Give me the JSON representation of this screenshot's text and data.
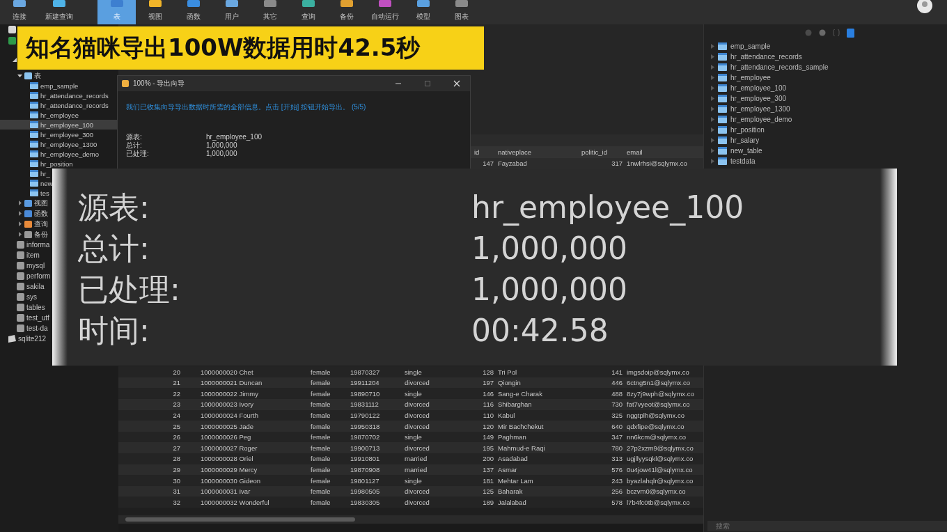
{
  "toolbar": {
    "items": [
      {
        "label": "连接",
        "selected": false
      },
      {
        "label": "新建查询",
        "selected": false
      },
      {
        "label": "表",
        "selected": true
      },
      {
        "label": "视图",
        "selected": false
      },
      {
        "label": "函数",
        "selected": false
      },
      {
        "label": "用户",
        "selected": false
      },
      {
        "label": "其它",
        "selected": false
      },
      {
        "label": "查询",
        "selected": false
      },
      {
        "label": "备份",
        "selected": false
      },
      {
        "label": "自动运行",
        "selected": false
      },
      {
        "label": "模型",
        "selected": false
      },
      {
        "label": "图表",
        "selected": false
      }
    ]
  },
  "banner": {
    "text": "知名猫咪导出100W数据用时42.5秒"
  },
  "sidebar": {
    "tree": [
      {
        "label": "表",
        "kind": "table",
        "expanded": true,
        "children": [
          {
            "label": "emp_sample",
            "selected": false
          },
          {
            "label": "hr_attendance_records",
            "selected": false
          },
          {
            "label": "hr_attendance_records",
            "selected": false
          },
          {
            "label": "hr_employee",
            "selected": false
          },
          {
            "label": "hr_employee_100",
            "selected": true
          },
          {
            "label": "hr_employee_300",
            "selected": false
          },
          {
            "label": "hr_employee_1300",
            "selected": false
          },
          {
            "label": "hr_employee_demo",
            "selected": false
          },
          {
            "label": "hr_position",
            "selected": false
          },
          {
            "label": "hr_",
            "selected": false
          },
          {
            "label": "new",
            "selected": false
          },
          {
            "label": "tes",
            "selected": false
          }
        ]
      },
      {
        "label": "视图",
        "kind": "view",
        "expanded": false
      },
      {
        "label": "函数",
        "kind": "function",
        "expanded": false
      },
      {
        "label": "查询",
        "kind": "query",
        "expanded": false
      },
      {
        "label": "备份",
        "kind": "backup",
        "expanded": false
      }
    ],
    "databases": [
      {
        "label": "informa"
      },
      {
        "label": "item"
      },
      {
        "label": "mysql"
      },
      {
        "label": "perform"
      },
      {
        "label": "sakila"
      },
      {
        "label": "sys"
      },
      {
        "label": "tables"
      },
      {
        "label": "test_utf"
      },
      {
        "label": "test-da"
      }
    ],
    "connections": [
      {
        "label": "sqlite212"
      }
    ]
  },
  "dialog": {
    "title": "100% - 导出向导",
    "message": "我们已收集向导导出数据时所需的全部信息。点击 [开始] 按钮开始导出。 (5/5)",
    "rows": [
      {
        "label": "源表:",
        "value": "hr_employee_100"
      },
      {
        "label": "总计:",
        "value": "1,000,000"
      },
      {
        "label": "已处理:",
        "value": "1,000,000"
      }
    ]
  },
  "inset": {
    "rows": [
      {
        "label": "源表:",
        "value": "hr_employee_100"
      },
      {
        "label": "总计:",
        "value": "1,000,000"
      },
      {
        "label": "已处理:",
        "value": "1,000,000"
      },
      {
        "label": "时间:",
        "value": "00:42.58"
      }
    ]
  },
  "results": {
    "header_labels": [
      "id",
      "nativeplace",
      "politic_id",
      "email"
    ],
    "top_row": [
      "147",
      "Fayzabad",
      "317",
      "1nwlrhsi@sqlymx.co"
    ],
    "rows": [
      [
        "20",
        "1000000020 Chet",
        "female",
        "19870327",
        "single",
        "128",
        "Tri Pol",
        "141",
        "imgsdoip@sqlymx.co"
      ],
      [
        "21",
        "1000000021 Duncan",
        "female",
        "19911204",
        "divorced",
        "197",
        "Qiongin",
        "446",
        "6ctng5n1@sqlymx.co"
      ],
      [
        "22",
        "1000000022 Jimmy",
        "female",
        "19890710",
        "single",
        "146",
        "Sang-e Charak",
        "488",
        "8zy7j9wph@sqlymx.co"
      ],
      [
        "23",
        "1000000023 Ivory",
        "female",
        "19831112",
        "divorced",
        "116",
        "Shibarghan",
        "730",
        "fat7vyeot@sqlymx.co"
      ],
      [
        "24",
        "1000000024 Fourth",
        "female",
        "19790122",
        "divorced",
        "110",
        "Kabul",
        "325",
        "nggtplh@sqlymx.co"
      ],
      [
        "25",
        "1000000025 Jade",
        "female",
        "19950318",
        "divorced",
        "120",
        "Mir Bachchekut",
        "640",
        "qdxfipe@sqlymx.co"
      ],
      [
        "26",
        "1000000026 Peg",
        "female",
        "19870702",
        "single",
        "149",
        "Paghman",
        "347",
        "nn6kcm@sqlymx.co"
      ],
      [
        "27",
        "1000000027 Roger",
        "female",
        "19900713",
        "divorced",
        "195",
        "Mahmud-e Raqi",
        "780",
        "27p2xzm9@sqlymx.co"
      ],
      [
        "28",
        "1000000028 Oriel",
        "female",
        "19910801",
        "married",
        "200",
        "Asadabad",
        "313",
        "ugjllyysqkl@sqlymx.co"
      ],
      [
        "29",
        "1000000029 Mercy",
        "female",
        "19870908",
        "married",
        "137",
        "Asmar",
        "576",
        "0u4jow41l@sqlymx.co"
      ],
      [
        "30",
        "1000000030 Gideon",
        "female",
        "19801127",
        "single",
        "181",
        "Mehtar Lam",
        "243",
        "byazlahqlr@sqlymx.co"
      ],
      [
        "31",
        "1000000031 Ivar",
        "female",
        "19980505",
        "divorced",
        "125",
        "Baharak",
        "256",
        "bczvm0@sqlymx.co"
      ],
      [
        "32",
        "1000000032 Wonderful",
        "female",
        "19830305",
        "divorced",
        "189",
        "Jalalabad",
        "578",
        "l7b4fc0tb@sqlymx.co"
      ]
    ]
  },
  "objects_panel": {
    "items": [
      {
        "label": "emp_sample"
      },
      {
        "label": "hr_attendance_records"
      },
      {
        "label": "hr_attendance_records_sample"
      },
      {
        "label": "hr_employee"
      },
      {
        "label": "hr_employee_100"
      },
      {
        "label": "hr_employee_300"
      },
      {
        "label": "hr_employee_1300"
      },
      {
        "label": "hr_employee_demo"
      },
      {
        "label": "hr_position"
      },
      {
        "label": "hr_salary"
      },
      {
        "label": "new_table"
      },
      {
        "label": "testdata"
      }
    ],
    "search": {
      "placeholder": "搜索"
    }
  }
}
